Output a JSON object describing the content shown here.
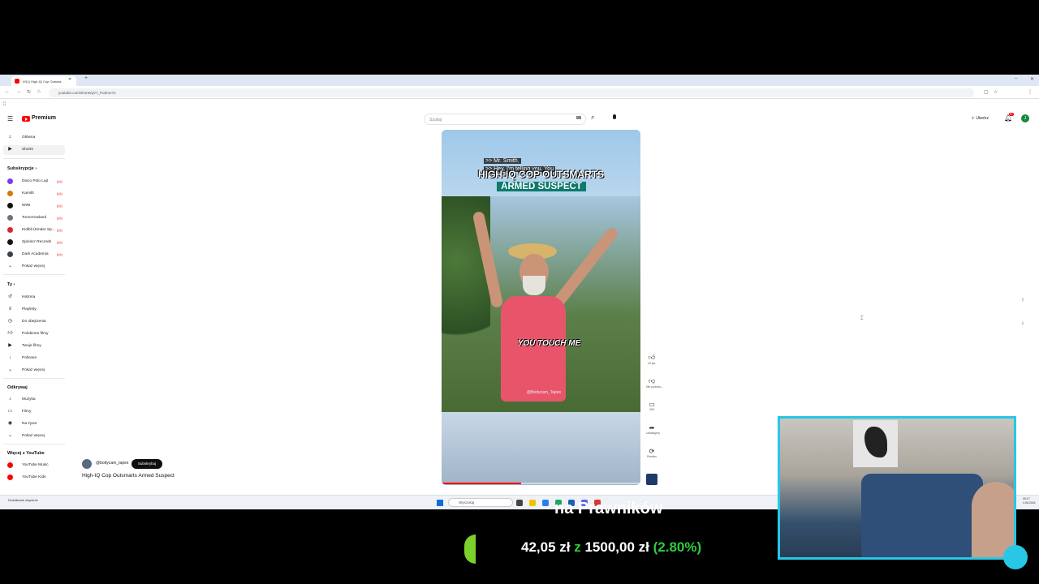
{
  "browser": {
    "tab_title": "(911) High-IQ Cop Outsma",
    "url": "youtube.com/shorts/qV7_PuZmnYo"
  },
  "header": {
    "logo_text": "Premium",
    "search_placeholder": "Szukaj",
    "create_label": "Utwórz",
    "notification_count": "9+",
    "avatar_letter": "J"
  },
  "sidebar": {
    "main": [
      {
        "label": "Główna",
        "icon": "home-icon"
      },
      {
        "label": "Shorts",
        "icon": "shorts-icon"
      }
    ],
    "subscriptions_heading": "Subskrypcje",
    "subscriptions": [
      {
        "label": "Disco Polo Lajt",
        "color": "#7c3aed"
      },
      {
        "label": "Kamil0",
        "color": "#d97706"
      },
      {
        "label": "WWI",
        "color": "#111111"
      },
      {
        "label": "Tomorrowland",
        "color": "#6b7280"
      },
      {
        "label": "Kidibli (Kinder Sp...",
        "color": "#dc2626"
      },
      {
        "label": "Spinnin' Records",
        "color": "#111111"
      },
      {
        "label": "Dark Academia",
        "color": "#374151"
      }
    ],
    "show_more_1": "Pokaż więcej",
    "you_heading": "Ty",
    "you_items": [
      {
        "label": "Historia",
        "icon": "history-icon"
      },
      {
        "label": "Playlisty",
        "icon": "playlist-icon"
      },
      {
        "label": "Do obejrzenia",
        "icon": "clock-icon"
      },
      {
        "label": "Polubione filmy",
        "icon": "like-icon"
      },
      {
        "label": "Twoje filmy",
        "icon": "video-icon"
      },
      {
        "label": "Pobrane",
        "icon": "download-icon"
      }
    ],
    "show_more_2": "Pokaż więcej",
    "explore_heading": "Odkrywaj",
    "explore_items": [
      {
        "label": "Muzyka",
        "icon": "music-icon"
      },
      {
        "label": "Filmy",
        "icon": "film-icon"
      },
      {
        "label": "Na żywo",
        "icon": "live-icon"
      }
    ],
    "show_more_3": "Pokaż więcej",
    "more_heading": "Więcej z YouTube",
    "more_items": [
      {
        "label": "YouTube Music",
        "color": "#ff0000"
      },
      {
        "label": "YouTube Kids",
        "color": "#ff0000"
      }
    ]
  },
  "video": {
    "caption_1": ">> Mr. Smith.",
    "caption_2": ">> Hey, I'm telling you. You",
    "title_line1": "HIGH-IQ COP OUTSMARTS",
    "title_line2": "ARMED SUSPECT",
    "subtitle": "YOU TOUCH ME",
    "watermark": "@Bodycam_Tapes",
    "progress": 0.4
  },
  "actions": {
    "likes": "15 tys.",
    "dislike": "Nie podoba...",
    "comments": "299",
    "share": "Udostępnij",
    "remix": "Remiks"
  },
  "channel": {
    "name": "@bodycam_tapes",
    "subscribe_label": "Subskrybuj",
    "video_title": "High-IQ Cop Outsmarts Armed Suspect"
  },
  "taskbar": {
    "weather": "Dodatkowe wiązanie",
    "search_label": "Wyszukaj",
    "clock_time": "09:17",
    "clock_date": "4.06.2024"
  },
  "overlay": {
    "title": "na Prawników",
    "amount_current": "42,05 zł",
    "amount_word": "z",
    "amount_goal": "1500,00 zł",
    "amount_pct": "(2.80%)",
    "accent_color": "#27c7e5"
  }
}
